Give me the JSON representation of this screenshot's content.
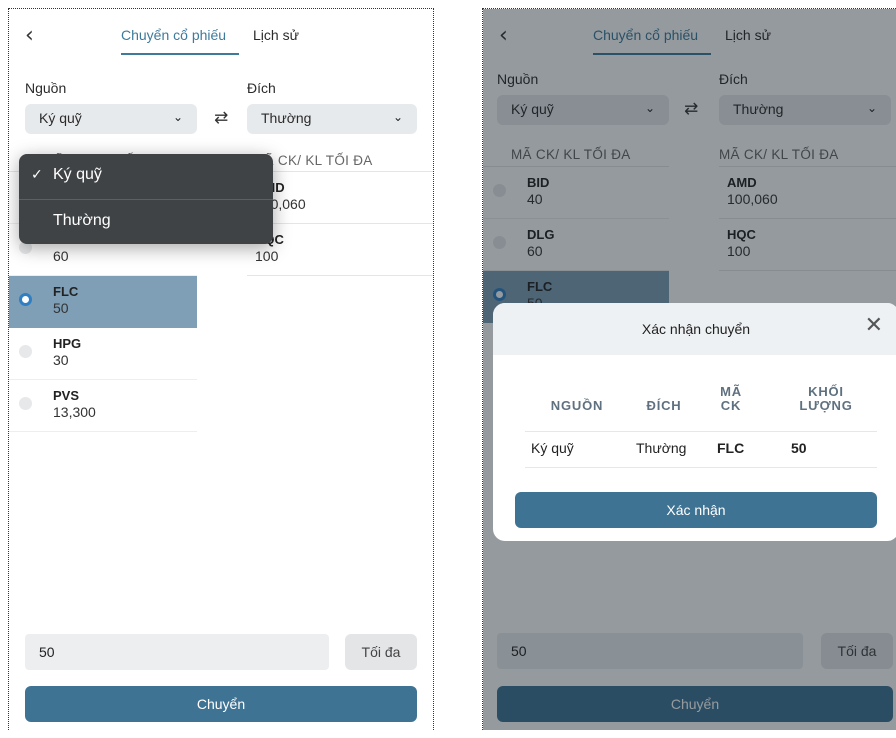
{
  "tabs": {
    "transfer": "Chuyển cổ phiếu",
    "history": "Lịch sử"
  },
  "labels": {
    "source": "Nguồn",
    "dest": "Đích",
    "col_source": "MÃ CK/ KL TỐI ĐA",
    "col_dest": "MÃ CK/ KL TỐI ĐA"
  },
  "source_value": "Ký quỹ",
  "dest_value": "Thường",
  "source_rows": [
    {
      "code": "BID",
      "qty": "40"
    },
    {
      "code": "DLG",
      "qty": "60"
    },
    {
      "code": "FLC",
      "qty": "50"
    },
    {
      "code": "HPG",
      "qty": "30"
    },
    {
      "code": "PVS",
      "qty": "13,300"
    }
  ],
  "dest_rows": [
    {
      "code": "AMD",
      "qty": "100,060"
    },
    {
      "code": "HQC",
      "qty": "100"
    }
  ],
  "dropdown": {
    "options": [
      "Ký quỹ",
      "Thường"
    ],
    "selected": "Ký quỹ"
  },
  "quantity_input": "50",
  "max_button": "Tối đa",
  "submit_button": "Chuyển",
  "modal": {
    "title": "Xác nhận chuyển",
    "headers": {
      "source": "NGUỒN",
      "dest": "ĐÍCH",
      "code_1": "MÃ",
      "code_2": "CK",
      "qty_1": "KHỐI",
      "qty_2": "LƯỢNG"
    },
    "row": {
      "source": "Ký quỹ",
      "dest": "Thường",
      "code": "FLC",
      "qty": "50"
    },
    "confirm_button": "Xác nhận"
  },
  "colors": {
    "accent": "#3f7394",
    "selected_row": "#7e9fb6",
    "dropdown_bg": "#404345"
  }
}
